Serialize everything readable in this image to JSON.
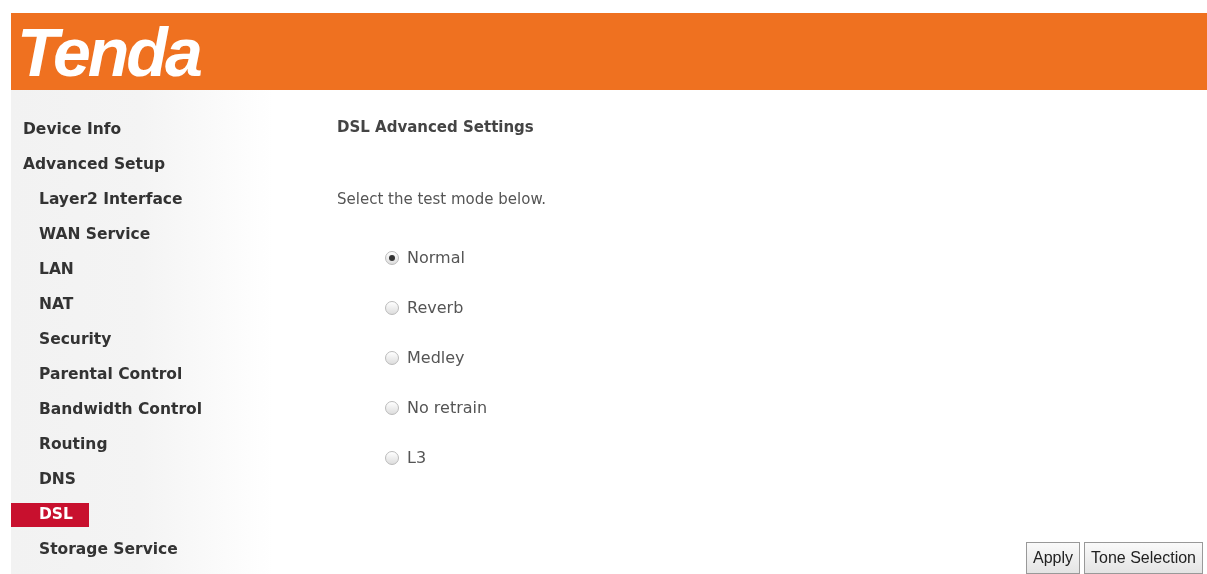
{
  "header": {
    "logo": "Tenda"
  },
  "sidebar": {
    "items": [
      {
        "label": "Device Info",
        "selected": false
      },
      {
        "label": "Advanced Setup",
        "selected": false,
        "children": [
          {
            "label": "Layer2 Interface",
            "selected": false
          },
          {
            "label": "WAN Service",
            "selected": false
          },
          {
            "label": "LAN",
            "selected": false
          },
          {
            "label": "NAT",
            "selected": false
          },
          {
            "label": "Security",
            "selected": false
          },
          {
            "label": "Parental Control",
            "selected": false
          },
          {
            "label": "Bandwidth Control",
            "selected": false
          },
          {
            "label": "Routing",
            "selected": false
          },
          {
            "label": "DNS",
            "selected": false
          },
          {
            "label": "DSL",
            "selected": true
          },
          {
            "label": "Storage Service",
            "selected": false
          }
        ]
      }
    ]
  },
  "content": {
    "title": "DSL Advanced Settings",
    "instruction": "Select the test mode below.",
    "modes": [
      {
        "label": "Normal",
        "selected": true
      },
      {
        "label": "Reverb",
        "selected": false
      },
      {
        "label": "Medley",
        "selected": false
      },
      {
        "label": "No retrain",
        "selected": false
      },
      {
        "label": "L3",
        "selected": false
      }
    ],
    "buttons": [
      "Apply",
      "Tone Selection"
    ]
  }
}
